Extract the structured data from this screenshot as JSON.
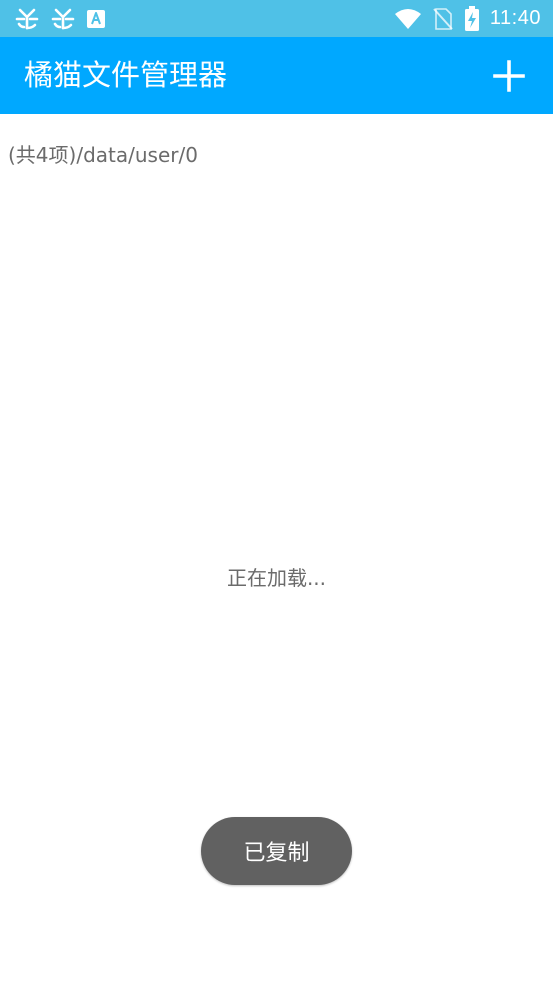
{
  "status_bar": {
    "left_icons": [
      "bug-icon",
      "bug-icon",
      "accessibility-a-icon"
    ],
    "right_icons": [
      "wifi-icon",
      "no-sim-icon",
      "battery-charging-icon"
    ],
    "time": "11:40",
    "background_color": "#4fc1e7"
  },
  "app_bar": {
    "title": "橘猫文件管理器",
    "action_icon": "plus-icon",
    "background_color": "#00a8ff"
  },
  "content": {
    "item_count": "(共4项)",
    "path": "/data/user/0",
    "loading_text": "正在加载..."
  },
  "toast": {
    "text": "已复制",
    "background_color": "#616161"
  }
}
